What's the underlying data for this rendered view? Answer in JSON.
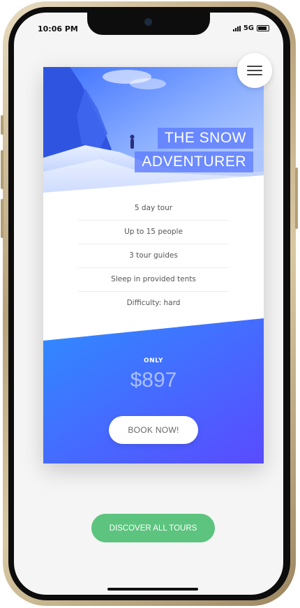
{
  "status_bar": {
    "time": "10:06 PM",
    "network": "5G"
  },
  "menu": {
    "icon": "hamburger-menu-icon"
  },
  "card": {
    "title_line1": "THE SNOW",
    "title_line2": "ADVENTURER",
    "features": [
      "5 day tour",
      "Up to 15 people",
      "3 tour guides",
      "Sleep in provided tents",
      "Difficulty: hard"
    ],
    "price_prefix": "ONLY",
    "price": "$897",
    "book_label": "BOOK NOW!"
  },
  "discover_label": "DISCOVER ALL TOURS",
  "colors": {
    "card_gradient_start": "#2f8cff",
    "card_gradient_end": "#5a4bff",
    "discover_button": "#5cc47e"
  }
}
